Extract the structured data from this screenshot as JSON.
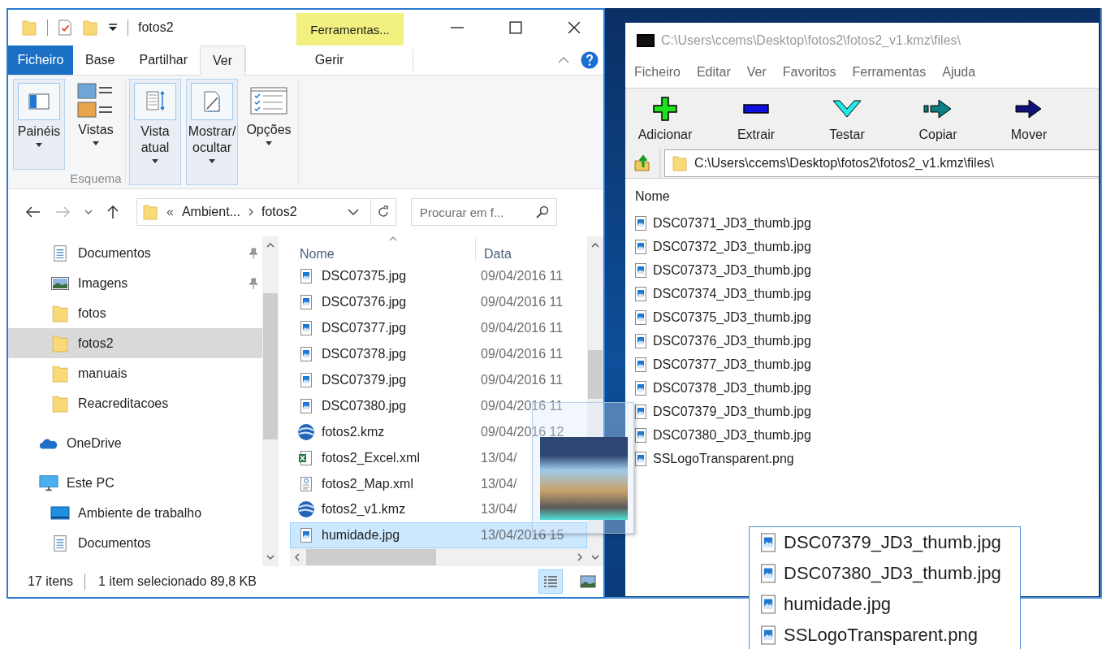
{
  "explorer": {
    "title": "fotos2",
    "context_tab": "Ferramentas...",
    "tabs": [
      {
        "label": "Ficheiro",
        "kind": "file",
        "selected": false
      },
      {
        "label": "Base",
        "kind": "tab",
        "selected": false
      },
      {
        "label": "Partilhar",
        "kind": "tab",
        "selected": false
      },
      {
        "label": "Ver",
        "kind": "tab",
        "selected": true
      }
    ],
    "context_subtab": "Gerir",
    "ribbon_groups": [
      {
        "label": "Esquema",
        "buttons": [
          {
            "label": "Painéis",
            "kind": "panes",
            "active": true
          },
          {
            "label": "Vistas",
            "kind": "layouts",
            "active": false
          }
        ]
      },
      {
        "buttons": [
          {
            "label": "Vista atual",
            "kind": "sort",
            "active": true
          },
          {
            "label": "Mostrar/ocultar",
            "kind": "showhide",
            "active": true
          },
          {
            "label": "Opções",
            "kind": "options",
            "active": false
          }
        ]
      }
    ],
    "address": {
      "overflow": "«",
      "path": [
        "Ambient...",
        "fotos2"
      ]
    },
    "search": {
      "placeholder": "Procurar em f..."
    },
    "quick_access": [
      {
        "label": "Documentos",
        "kind": "document",
        "pinned": true,
        "selected": false
      },
      {
        "label": "Imagens",
        "kind": "pictures",
        "pinned": true,
        "selected": false
      },
      {
        "label": "fotos",
        "kind": "folder",
        "pinned": false,
        "selected": false
      },
      {
        "label": "fotos2",
        "kind": "folder",
        "pinned": false,
        "selected": true
      },
      {
        "label": "manuais",
        "kind": "folder",
        "pinned": false,
        "selected": false
      },
      {
        "label": "Reacreditacoes",
        "kind": "folder",
        "pinned": false,
        "selected": false
      }
    ],
    "locations": [
      {
        "label": "OneDrive",
        "kind": "cloud"
      },
      {
        "label": "Este PC",
        "kind": "computer",
        "children": [
          {
            "label": "Ambiente de trabalho",
            "kind": "desktop"
          },
          {
            "label": "Documentos",
            "kind": "document"
          }
        ]
      }
    ],
    "columns": [
      "Nome",
      "Data"
    ],
    "files": [
      {
        "name": "DSC07375.jpg",
        "date": "09/04/2016 11",
        "kind": "image",
        "selected": false
      },
      {
        "name": "DSC07376.jpg",
        "date": "09/04/2016 11",
        "kind": "image",
        "selected": false
      },
      {
        "name": "DSC07377.jpg",
        "date": "09/04/2016 11",
        "kind": "image",
        "selected": false
      },
      {
        "name": "DSC07378.jpg",
        "date": "09/04/2016 11",
        "kind": "image",
        "selected": false
      },
      {
        "name": "DSC07379.jpg",
        "date": "09/04/2016 11",
        "kind": "image",
        "selected": false
      },
      {
        "name": "DSC07380.jpg",
        "date": "09/04/2016 11",
        "kind": "image",
        "selected": false
      },
      {
        "name": "fotos2.kmz",
        "date": "09/04/2016 12",
        "kind": "globe",
        "selected": false
      },
      {
        "name": "fotos2_Excel.xml",
        "date": "13/04/",
        "kind": "excel",
        "selected": false
      },
      {
        "name": "fotos2_Map.xml",
        "date": "13/04/",
        "kind": "xml",
        "selected": false
      },
      {
        "name": "fotos2_v1.kmz",
        "date": "13/04/",
        "kind": "globe",
        "selected": false
      },
      {
        "name": "humidade.jpg",
        "date": "13/04/2016 15",
        "kind": "image",
        "selected": true
      }
    ],
    "status": {
      "count": "17 itens",
      "selection": "1 item selecionado 89,8 KB"
    },
    "views": [
      {
        "kind": "details",
        "selected": true
      },
      {
        "kind": "thumbnails",
        "selected": false
      }
    ]
  },
  "sevenzip": {
    "title": "C:\\Users\\ccems\\Desktop\\fotos2\\fotos2_v1.kmz\\files\\",
    "menu": [
      "Ficheiro",
      "Editar",
      "Ver",
      "Favoritos",
      "Ferramentas",
      "Ajuda"
    ],
    "toolbar": [
      {
        "label": "Adicionar",
        "kind": "add"
      },
      {
        "label": "Extrair",
        "kind": "extract"
      },
      {
        "label": "Testar",
        "kind": "test"
      },
      {
        "label": "Copiar",
        "kind": "copy"
      },
      {
        "label": "Mover",
        "kind": "move"
      }
    ],
    "path": "C:\\Users\\ccems\\Desktop\\fotos2\\fotos2_v1.kmz\\files\\",
    "column": "Nome",
    "files": [
      "DSC07371_JD3_thumb.jpg",
      "DSC07372_JD3_thumb.jpg",
      "DSC07373_JD3_thumb.jpg",
      "DSC07374_JD3_thumb.jpg",
      "DSC07375_JD3_thumb.jpg",
      "DSC07376_JD3_thumb.jpg",
      "DSC07377_JD3_thumb.jpg",
      "DSC07378_JD3_thumb.jpg",
      "DSC07379_JD3_thumb.jpg",
      "DSC07380_JD3_thumb.jpg",
      "SSLogoTransparent.png"
    ]
  },
  "inset": {
    "files": [
      "DSC07379_JD3_thumb.jpg",
      "DSC07380_JD3_thumb.jpg",
      "humidade.jpg",
      "SSLogoTransparent.png"
    ]
  }
}
